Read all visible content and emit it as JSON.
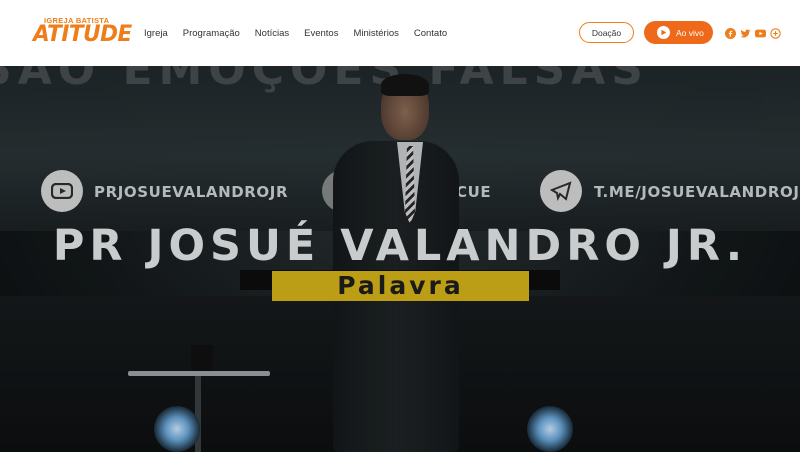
{
  "brand": {
    "logo_small": "IGREJA BATISTA",
    "logo_big": "ATITUDE",
    "accent_color": "#ee7d1a"
  },
  "nav": {
    "items": [
      {
        "label": "Igreja"
      },
      {
        "label": "Programação"
      },
      {
        "label": "Notícias"
      },
      {
        "label": "Eventos"
      },
      {
        "label": "Ministérios"
      },
      {
        "label": "Contato"
      }
    ]
  },
  "actions": {
    "donate_label": "Doação",
    "live_label": "Ao vivo"
  },
  "social_icons": [
    "facebook-icon",
    "twitter-icon",
    "youtube-icon",
    "plus-icon"
  ],
  "hero": {
    "background_text": "SÃO EMOÇÕES FALSAS",
    "youtube_handle": "PRJOSUEVALANDROJR",
    "instagram_handle": "CUE",
    "telegram_handle": "T.ME/JOSUEVALANDROJ",
    "speaker_title": "PR JOSUÉ VALANDRO JR.",
    "subtitle": "Palavra",
    "highlight_color": "#bb9d16"
  }
}
